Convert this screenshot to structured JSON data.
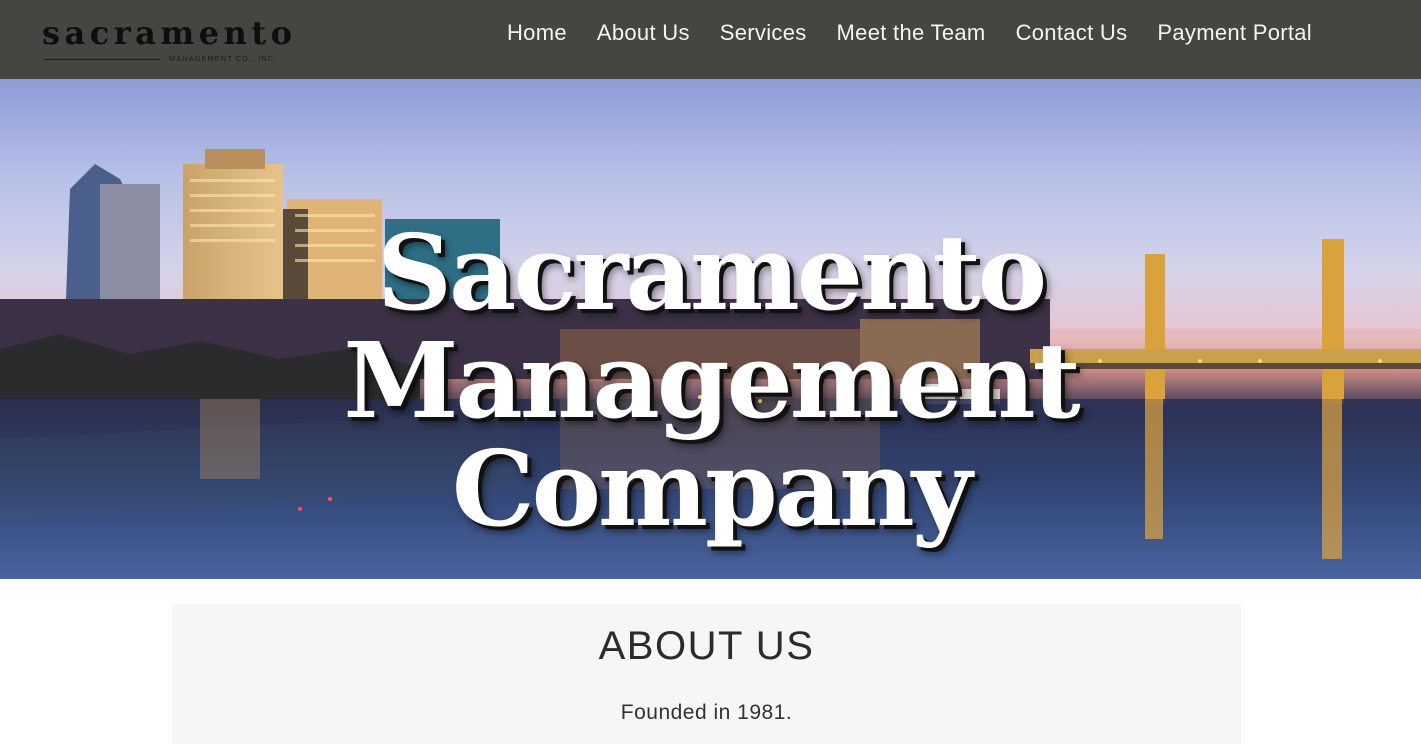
{
  "header": {
    "logo": {
      "wordmark": "sacramento",
      "subtitle": "MANAGEMENT CO., INC."
    },
    "nav": [
      {
        "label": "Home"
      },
      {
        "label": "About Us"
      },
      {
        "label": "Services"
      },
      {
        "label": "Meet the Team"
      },
      {
        "label": "Contact Us"
      },
      {
        "label": "Payment Portal"
      }
    ]
  },
  "hero": {
    "title_line1": "Sacramento Management",
    "title_line2": "Company",
    "background": "city-skyline-river-photo"
  },
  "about": {
    "heading": "ABOUT US",
    "text": "Founded in 1981."
  },
  "colors": {
    "header_bg": "#444641",
    "nav_text": "#f4f4f2",
    "section_bg": "#f6f6f6"
  }
}
